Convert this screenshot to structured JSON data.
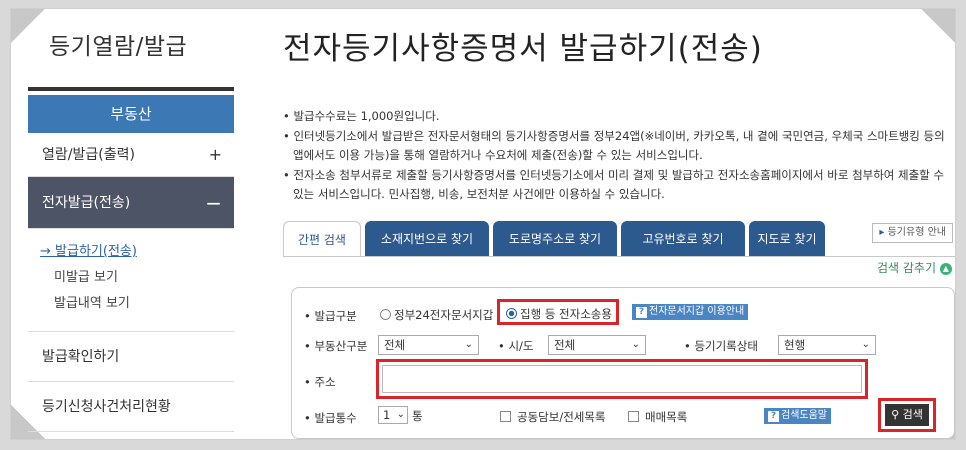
{
  "sidebar": {
    "section_title": "등기열람/발급",
    "header": "부동산",
    "items": [
      {
        "label": "열람/발급(출력)",
        "toggle": "+"
      },
      {
        "label": "전자발급(전송)",
        "toggle": "−"
      }
    ],
    "sub_items": [
      {
        "label": "발급하기(전송)",
        "prefix": "→ "
      },
      {
        "label": "미발급 보기"
      },
      {
        "label": "발급내역 보기"
      }
    ],
    "bottom_items": [
      {
        "label": "발급확인하기"
      },
      {
        "label": "등기신청사건처리현황"
      }
    ]
  },
  "page": {
    "title": "전자등기사항증명서 발급하기(전송)"
  },
  "notes": [
    "• 발급수수료는 1,000원입니다.",
    "• 인터넷등기소에서 발급받은 전자문서형태의 등기사항증명서를 정부24앱(※네이버, 카카오톡, 내 곁에 국민연금, 우체국 스마트뱅킹 등의 앱에서도 이용 가능)을 통해 열람하거나 수요처에 제출(전송)할 수 있는 서비스입니다.",
    "• 전자소송 첨부서류로 제출할 등기사항증명서를 인터넷등기소에서 미리 결제 및 발급하고 전자소송홈페이지에서 바로 첨부하여 제출할 수 있는 서비스입니다. 민사집행, 비송, 보전처분 사건에만 이용하실 수 있습니다."
  ],
  "tabs": [
    "간편 검색",
    "소재지번으로 찾기",
    "도로명주소로 찾기",
    "고유번호로 찾기",
    "지도로 찾기"
  ],
  "guide_button": {
    "label": "등기유형 안내",
    "marker": "▸"
  },
  "collapse": {
    "label": "검색 감추기",
    "icon": "▲"
  },
  "form": {
    "issue_type": {
      "label": "• 발급구분",
      "options": [
        "정부24전자문서지갑",
        "집행 등 전자소송용"
      ],
      "selected": "집행 등 전자소송용",
      "help": "전자문서지갑 이용안내"
    },
    "property_type": {
      "label": "• 부동산구분",
      "value": "전체"
    },
    "region": {
      "label": "• 시/도",
      "value": "전체"
    },
    "record_status": {
      "label": "• 등기기록상태",
      "value": "현행"
    },
    "address": {
      "label": "• 주소",
      "value": ""
    },
    "copies": {
      "label": "• 발급통수",
      "value": "1",
      "unit": "통"
    },
    "checkboxes": [
      "공동담보/전세목록",
      "매매목록"
    ],
    "search_help": "검색도움말",
    "search_button": "검색"
  }
}
